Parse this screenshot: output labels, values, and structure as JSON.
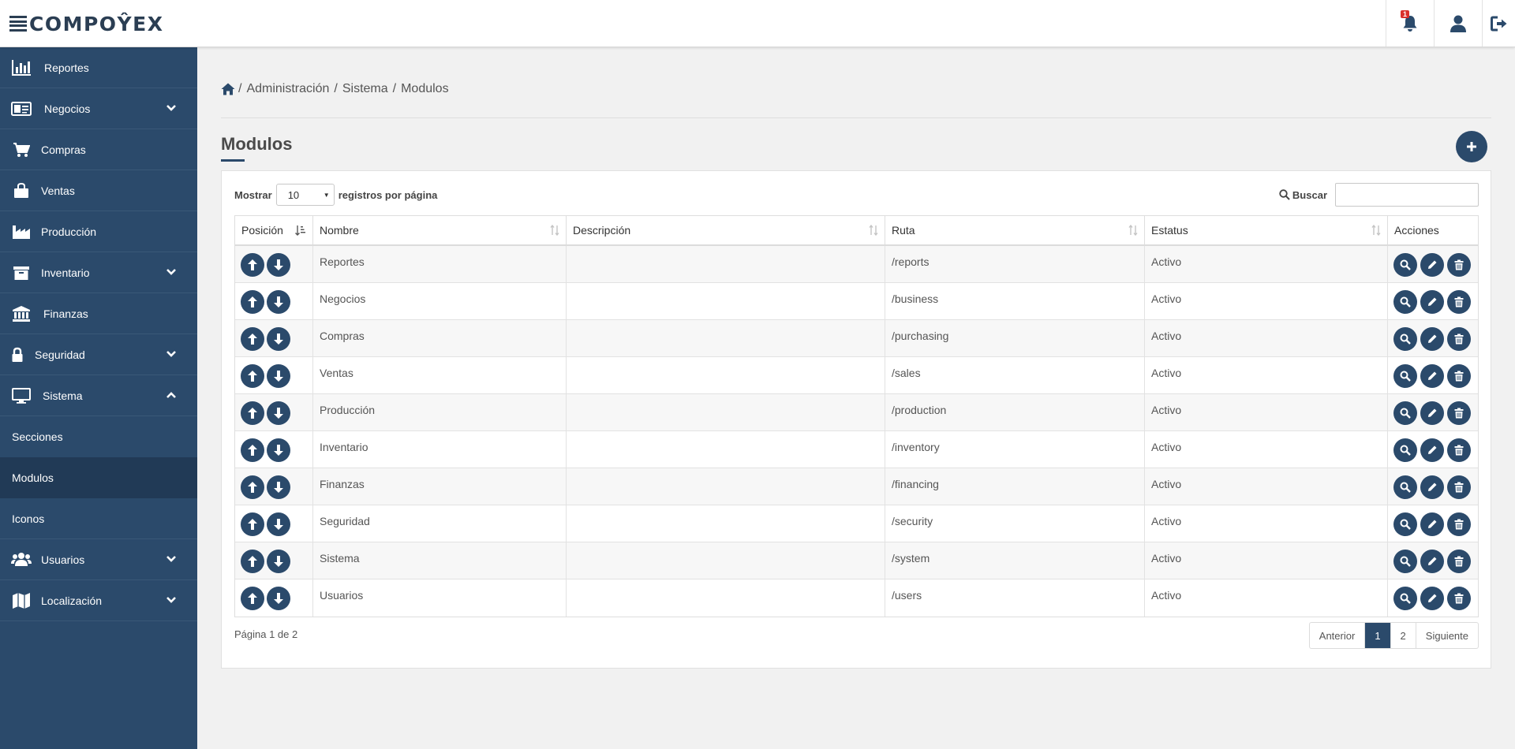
{
  "app": {
    "logo_text": "COMPOŶEX"
  },
  "header": {
    "notification_count": "1"
  },
  "sidebar": {
    "items": [
      {
        "label": "Reportes",
        "icon": "bar-chart-icon"
      },
      {
        "label": "Negocios",
        "icon": "id-card-icon"
      },
      {
        "label": "Compras",
        "icon": "cart-icon"
      },
      {
        "label": "Ventas",
        "icon": "shopping-bag-icon"
      },
      {
        "label": "Producción",
        "icon": "factory-icon"
      },
      {
        "label": "Inventario",
        "icon": "archive-icon"
      },
      {
        "label": "Finanzas",
        "icon": "bank-icon"
      },
      {
        "label": "Seguridad",
        "icon": "lock-icon"
      },
      {
        "label": "Sistema",
        "icon": "monitor-icon"
      },
      {
        "label": "Usuarios",
        "icon": "users-icon"
      },
      {
        "label": "Localización",
        "icon": "map-icon"
      }
    ],
    "sistema_sub": [
      {
        "label": "Secciones"
      },
      {
        "label": "Modulos",
        "active": true
      },
      {
        "label": "Iconos"
      }
    ]
  },
  "breadcrumb": {
    "items": [
      "Administración",
      "Sistema",
      "Modulos"
    ],
    "sep": "/"
  },
  "page": {
    "title": "Modulos"
  },
  "table_controls": {
    "show_label": "Mostrar",
    "page_size": "10",
    "per_page_label": "registros por página",
    "search_label": "Buscar"
  },
  "table": {
    "headers": [
      "Posición",
      "Nombre",
      "Descripción",
      "Ruta",
      "Estatus",
      "Acciones"
    ],
    "rows": [
      {
        "nombre": "Reportes",
        "descripcion": "",
        "ruta": "/reports",
        "estatus": "Activo"
      },
      {
        "nombre": "Negocios",
        "descripcion": "",
        "ruta": "/business",
        "estatus": "Activo"
      },
      {
        "nombre": "Compras",
        "descripcion": "",
        "ruta": "/purchasing",
        "estatus": "Activo"
      },
      {
        "nombre": "Ventas",
        "descripcion": "",
        "ruta": "/sales",
        "estatus": "Activo"
      },
      {
        "nombre": "Producción",
        "descripcion": "",
        "ruta": "/production",
        "estatus": "Activo"
      },
      {
        "nombre": "Inventario",
        "descripcion": "",
        "ruta": "/inventory",
        "estatus": "Activo"
      },
      {
        "nombre": "Finanzas",
        "descripcion": "",
        "ruta": "/financing",
        "estatus": "Activo"
      },
      {
        "nombre": "Seguridad",
        "descripcion": "",
        "ruta": "/security",
        "estatus": "Activo"
      },
      {
        "nombre": "Sistema",
        "descripcion": "",
        "ruta": "/system",
        "estatus": "Activo"
      },
      {
        "nombre": "Usuarios",
        "descripcion": "",
        "ruta": "/users",
        "estatus": "Activo"
      }
    ]
  },
  "footer": {
    "page_info": "Página 1 de 2",
    "prev_label": "Anterior",
    "pages": [
      "1",
      "2"
    ],
    "current_page": "1",
    "next_label": "Siguiente"
  },
  "colors": {
    "primary": "#2b4a6b",
    "sidebar_active": "#213a56",
    "badge": "#d9312b",
    "background": "#f1f1f1"
  }
}
